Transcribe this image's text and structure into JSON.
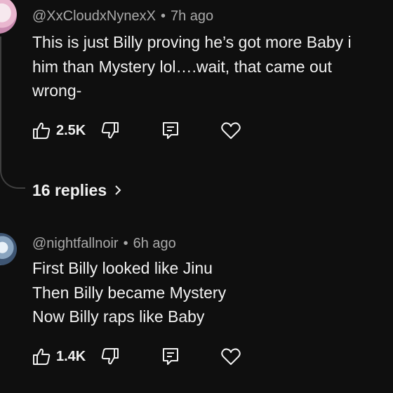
{
  "comments": [
    {
      "handle": "@XxCloudxNynexX",
      "separator": "•",
      "time": "7h ago",
      "lines": [
        "This is just Billy proving he’s got more Baby i",
        "him than Mystery lol….wait, that came out",
        "wrong-"
      ],
      "likes": "2.5K",
      "icons": {
        "like": "thumbs-up-icon",
        "dislike": "thumbs-down-icon",
        "reply": "reply-icon",
        "heart": "heart-icon"
      }
    },
    {
      "handle": "@nightfallnoir",
      "separator": "•",
      "time": "6h ago",
      "lines": [
        "First Billy looked like Jinu",
        "Then Billy became Mystery",
        "Now Billy raps like Baby"
      ],
      "likes": "1.4K",
      "icons": {
        "like": "thumbs-up-icon",
        "dislike": "thumbs-down-icon",
        "reply": "reply-icon",
        "heart": "heart-icon"
      }
    }
  ],
  "replies": {
    "label": "16 replies",
    "icon": "chevron-right-icon"
  },
  "colors": {
    "background": "#0f0f0f",
    "text": "#f1f1f1",
    "meta": "#aaaaaa",
    "thread_line": "#3f3f3f"
  }
}
